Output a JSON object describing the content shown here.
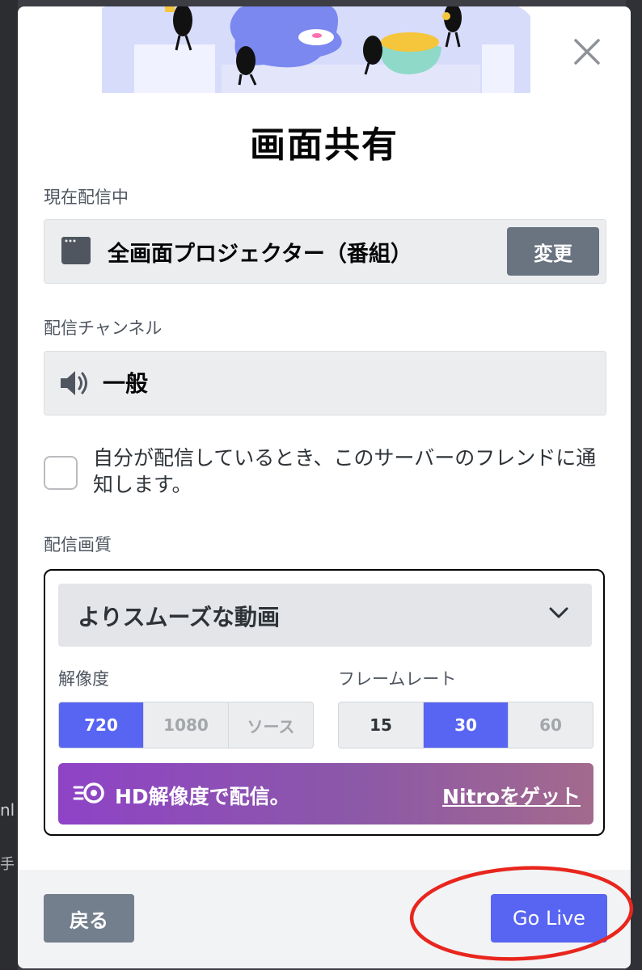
{
  "modal": {
    "title": "画面共有",
    "current_stream": {
      "label": "現在配信中",
      "source_name": "全画面プロジェクター（番組）",
      "change_label": "変更"
    },
    "channel": {
      "label": "配信チャンネル",
      "name": "一般"
    },
    "notify": {
      "checked": false,
      "text": "自分が配信しているとき、このサーバーのフレンドに通知します。"
    },
    "quality": {
      "label": "配信画質",
      "preset": "よりスムーズな動画",
      "resolution_label": "解像度",
      "resolution_options": [
        "720",
        "1080",
        "ソース"
      ],
      "resolution_selected": "720",
      "framerate_label": "フレームレート",
      "framerate_options": [
        "15",
        "30",
        "60"
      ],
      "framerate_selected": "30"
    },
    "nitro": {
      "text": "HD解像度で配信。",
      "link": "Nitroをゲット"
    },
    "footer": {
      "back_label": "戻る",
      "go_live_label": "Go Live"
    }
  },
  "background": {
    "text1": "nl",
    "text2": "手"
  },
  "colors": {
    "accent": "#5865f2",
    "annotation_red": "#e8261d",
    "secondary_button": "#747f8d"
  }
}
